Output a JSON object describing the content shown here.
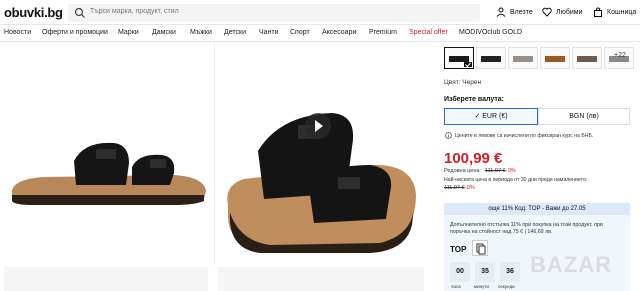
{
  "header": {
    "logo": "obuvki.bg",
    "search_placeholder": "Търси марка, продукт, стил",
    "login_label": "Влезте",
    "favorites_label": "Любими",
    "cart_label": "Кошница"
  },
  "nav": [
    "Новости",
    "Оферти и промоции",
    "Марки",
    "Дамски",
    "Мъжки",
    "Детски",
    "Чанти",
    "Спорт",
    "Аксесоари",
    "Premium",
    "Special offer",
    "MODIVOclub GOLD"
  ],
  "product": {
    "more_colors": "+22",
    "color_label": "Цвят: Черен",
    "currency_title": "Изберете валута:",
    "currency_eur": "✓ EUR (€)",
    "currency_bgn": "BGN (лв)",
    "currency_note": "Цените в левове са изчислени по фиксиран курс на БНБ.",
    "price": "100,99 €",
    "regular_price_label": "Редовна цена:",
    "regular_price": "111,97 €",
    "regular_discount": "-9%",
    "lowest_price_label": "Най-ниската цена в периода от 30 дни преди намалението:",
    "lowest_price": "111,97 €",
    "lowest_discount": "-9%"
  },
  "promo": {
    "header": "още 11% Код: TOP - Важи до 27.05",
    "text1": "Допълнително отстъпка 11% при покупка на този продукт, при",
    "text2": "поръчка на стойност над 75 € | 146,69 лв.",
    "code": "TOP",
    "hours": "00",
    "minutes": "35",
    "seconds": "36",
    "hours_label": "часа",
    "minutes_label": "минути",
    "seconds_label": "секунди"
  },
  "watermark": "BAZAR"
}
